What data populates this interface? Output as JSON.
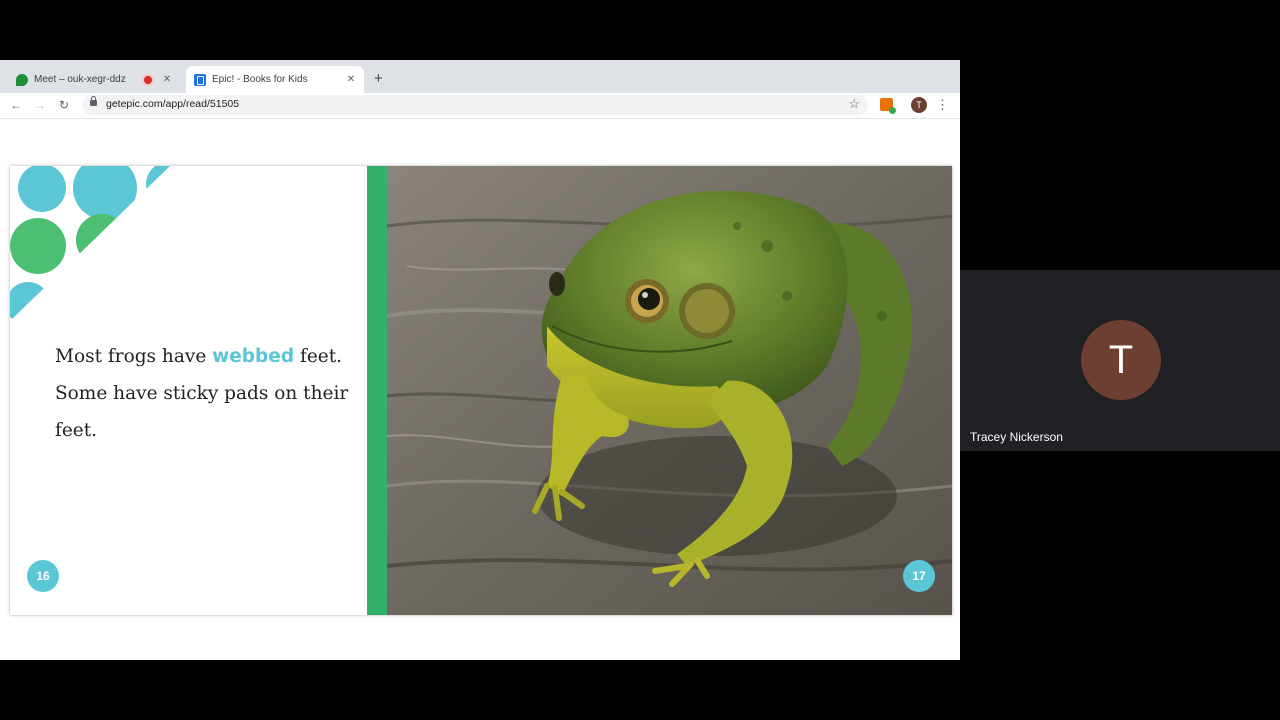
{
  "browser": {
    "tabs": [
      {
        "title": "Meet – ouk-xegr-ddz",
        "icon": "meet-icon",
        "recording": true,
        "active": false
      },
      {
        "title": "Epic! - Books for Kids",
        "icon": "epic-icon",
        "active": true
      }
    ],
    "close_glyph": "✕",
    "new_tab_glyph": "+",
    "url": "getepic.com/app/read/51505",
    "profile_initial": "T"
  },
  "book": {
    "text_before": "Most frogs have ",
    "highlight_word": "webbed",
    "text_after": " feet. Some have sticky pads on their feet.",
    "left_page_number": "16",
    "right_page_number": "17",
    "accent_color": "#5ac6d6",
    "stripe_color": "#35b06a"
  },
  "participant": {
    "name": "Tracey Nickerson",
    "initial": "T",
    "avatar_color": "#6d3f33"
  }
}
